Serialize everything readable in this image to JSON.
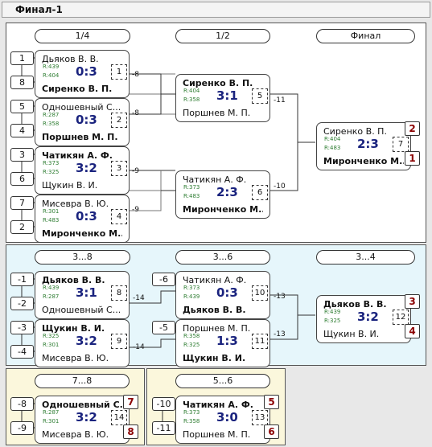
{
  "window_title": "Финал-1",
  "sections": {
    "main": {
      "round_labels": [
        "1/4",
        "1/2",
        "Финал"
      ]
    },
    "losers_3_8": {
      "round_labels": [
        "3...8",
        "3...6",
        "3...4"
      ]
    },
    "place_7_8": {
      "label": "7...8"
    },
    "place_5_6": {
      "label": "5...6"
    }
  },
  "seeds": [
    "1",
    "8",
    "5",
    "4",
    "3",
    "6",
    "7",
    "2",
    "-1",
    "-2",
    "-3",
    "-4",
    "-6",
    "-5",
    "-8",
    "-9",
    "-10",
    "-11"
  ],
  "line_labels": [
    "-8",
    "-8",
    "-9",
    "-9",
    "-11",
    "-10",
    "-14",
    "-14",
    "-13",
    "-13"
  ],
  "place_badges": [
    "2",
    "1",
    "3",
    "4",
    "7",
    "8",
    "5",
    "6"
  ],
  "matches": [
    {
      "num": "1",
      "score": "0:3",
      "p1": "Дьяков В. В.",
      "r1": "R:439",
      "p2": "Сиренко В. П.",
      "r2": "R:404",
      "winner": 2
    },
    {
      "num": "2",
      "score": "0:3",
      "p1": "Одношевный С...",
      "r1": "R:287",
      "p2": "Поршнев М. П.",
      "r2": "R:358",
      "winner": 2
    },
    {
      "num": "3",
      "score": "3:2",
      "p1": "Чатикян А. Ф.",
      "r1": "R:373",
      "p2": "Щукин В. И.",
      "r2": "R:325",
      "winner": 1
    },
    {
      "num": "4",
      "score": "0:3",
      "p1": "Мисевра В. Ю.",
      "r1": "R:301",
      "p2": "Миронченко М....",
      "r2": "R:483",
      "winner": 2
    },
    {
      "num": "5",
      "score": "3:1",
      "p1": "Сиренко В. П.",
      "r1": "R:404",
      "p2": "Поршнев М. П.",
      "r2": "R:358",
      "winner": 1
    },
    {
      "num": "6",
      "score": "2:3",
      "p1": "Чатикян А. Ф.",
      "r1": "R:373",
      "p2": "Миронченко М....",
      "r2": "R:483",
      "winner": 2
    },
    {
      "num": "7",
      "score": "2:3",
      "p1": "Сиренко В. П.",
      "r1": "R:404",
      "p2": "Миронченко М....",
      "r2": "R:483",
      "winner": 2
    },
    {
      "num": "8",
      "score": "3:1",
      "p1": "Дьяков В. В.",
      "r1": "R:439",
      "p2": "Одношевный С...",
      "r2": "R:287",
      "winner": 1
    },
    {
      "num": "9",
      "score": "3:2",
      "p1": "Щукин В. И.",
      "r1": "R:325",
      "p2": "Мисевра В. Ю.",
      "r2": "R:301",
      "winner": 1
    },
    {
      "num": "10",
      "score": "0:3",
      "p1": "Чатикян А. Ф.",
      "r1": "R:373",
      "p2": "Дьяков В. В.",
      "r2": "R:439",
      "winner": 2
    },
    {
      "num": "11",
      "score": "1:3",
      "p1": "Поршнев М. П.",
      "r1": "R:358",
      "p2": "Щукин В. И.",
      "r2": "R:325",
      "winner": 2
    },
    {
      "num": "12",
      "score": "3:2",
      "p1": "Дьяков В. В.",
      "r1": "R:439",
      "p2": "Щукин В. И.",
      "r2": "R:325",
      "winner": 1
    },
    {
      "num": "14",
      "score": "3:2",
      "p1": "Одношевный С...",
      "r1": "R:287",
      "p2": "Мисевра В. Ю.",
      "r2": "R:301",
      "winner": 1
    },
    {
      "num": "13",
      "score": "3:0",
      "p1": "Чатикян А. Ф.",
      "r1": "R:373",
      "p2": "Поршнев М. П.",
      "r2": "R:358",
      "winner": 1
    }
  ],
  "colors": {
    "main_panel": "#ffffff",
    "losers_panel": "#e6f6fb",
    "placement_panel": "#fbf7dc",
    "score": "#1a237e",
    "rating": "#2e7d32",
    "place": "#8b0000"
  }
}
